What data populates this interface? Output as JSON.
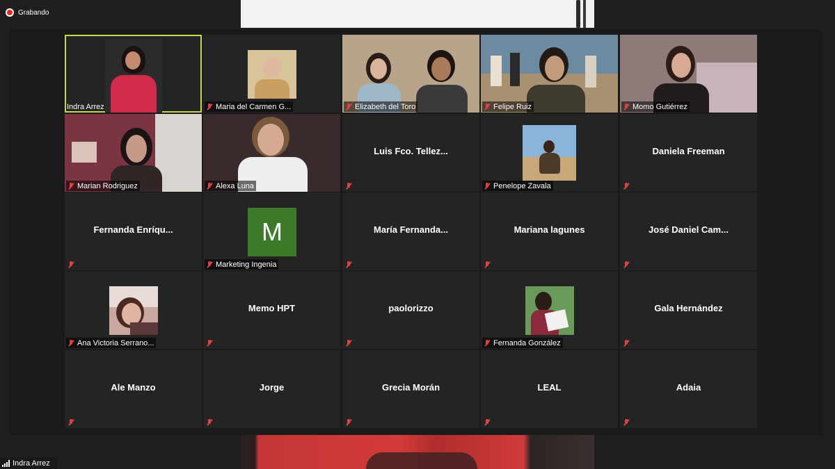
{
  "recording": {
    "label": "Grabando"
  },
  "status_bar": {
    "name": "Indra Arrez"
  },
  "participants": [
    {
      "name": "Indra Arrez",
      "video": true,
      "active": true,
      "muted": false
    },
    {
      "name": "Maria del Carmen G...",
      "video": true,
      "muted": true
    },
    {
      "name": "Elizabeth del Toro",
      "video": true,
      "muted": true
    },
    {
      "name": "Felipe Ruiz",
      "video": true,
      "muted": true
    },
    {
      "name": "Momo Gutiérrez",
      "video": true,
      "muted": true
    },
    {
      "name": "Marian Rodriguez",
      "video": true,
      "muted": true
    },
    {
      "name": "Alexa Luna",
      "video": true,
      "muted": true
    },
    {
      "name": "Luis  Fco.  Tellez...",
      "video": false,
      "muted": true
    },
    {
      "name": "Penelope Zavala",
      "video": true,
      "muted": true
    },
    {
      "name": "Daniela Freeman",
      "video": false,
      "muted": true
    },
    {
      "name": "Fernanda  Enríqu...",
      "video": false,
      "muted": true
    },
    {
      "name": "Marketing Ingenia",
      "avatar_letter": "M",
      "avatar_color": "#3d7a2a",
      "muted": true
    },
    {
      "name": "María  Fernanda...",
      "video": false,
      "muted": true
    },
    {
      "name": "Mariana lagunes",
      "video": false,
      "muted": true
    },
    {
      "name": "José  Daniel  Cam...",
      "video": false,
      "muted": true
    },
    {
      "name": "Ana Victoria Serrano...",
      "video": true,
      "muted": true
    },
    {
      "name": "Memo HPT",
      "video": false,
      "muted": true
    },
    {
      "name": "paolorizzo",
      "video": false,
      "muted": true
    },
    {
      "name": "Fernanda González",
      "video": true,
      "muted": true
    },
    {
      "name": "Gala Hernández",
      "video": false,
      "muted": true
    },
    {
      "name": "Ale Manzo",
      "video": false,
      "muted": true
    },
    {
      "name": "Jorge",
      "video": false,
      "muted": true
    },
    {
      "name": "Grecia Morán",
      "video": false,
      "muted": true
    },
    {
      "name": "LEAL",
      "video": false,
      "muted": true
    },
    {
      "name": "Adaia",
      "video": false,
      "muted": true
    }
  ],
  "colors": {
    "active_border": "#c9d84f",
    "mute_red": "#e04141",
    "recording_red": "#e02828"
  },
  "icons": {
    "mute": "muted-microphone-icon",
    "recording": "recording-dot-icon",
    "signal": "signal-bars-icon"
  }
}
